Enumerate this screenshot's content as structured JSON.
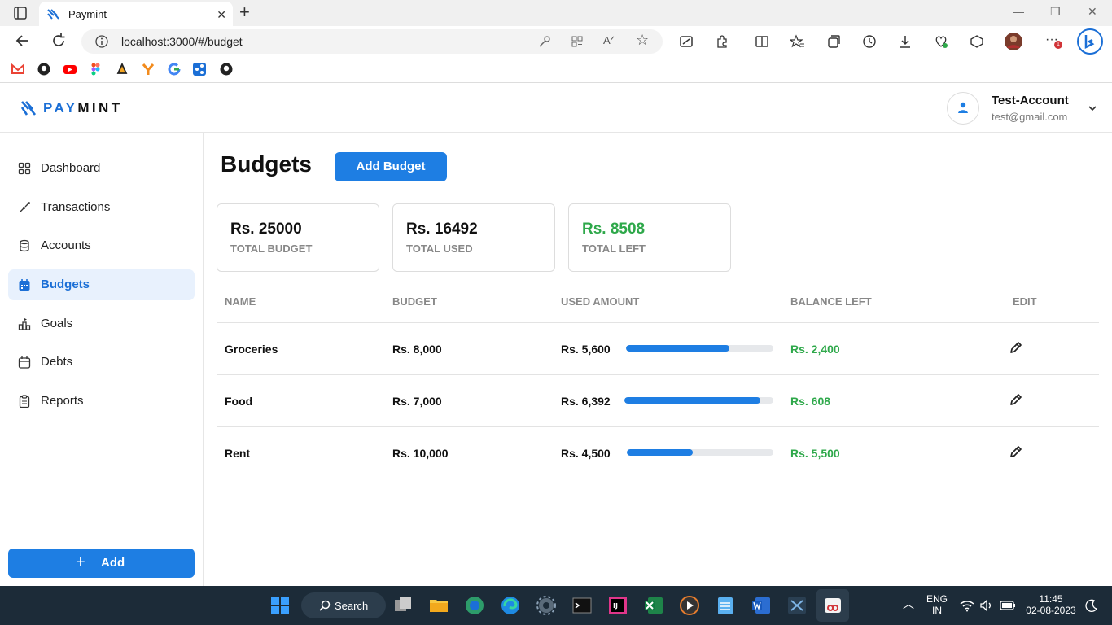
{
  "browser": {
    "tab_title": "Paymint",
    "url": "localhost:3000/#/budget"
  },
  "app": {
    "logo_left": "PAY",
    "logo_right": "MINT"
  },
  "profile": {
    "name": "Test-Account",
    "email": "test@gmail.com"
  },
  "sidebar": {
    "items": [
      {
        "label": "Dashboard",
        "icon": "grid-icon"
      },
      {
        "label": "Transactions",
        "icon": "arrows-icon"
      },
      {
        "label": "Accounts",
        "icon": "database-icon"
      },
      {
        "label": "Budgets",
        "icon": "calendar-icon",
        "active": true
      },
      {
        "label": "Goals",
        "icon": "goals-icon"
      },
      {
        "label": "Debts",
        "icon": "calendar-icon"
      },
      {
        "label": "Reports",
        "icon": "clipboard-icon"
      }
    ],
    "add_label": "Add"
  },
  "page": {
    "title": "Budgets",
    "add_budget_label": "Add Budget"
  },
  "summary": [
    {
      "value": "Rs. 25000",
      "caption": "TOTAL BUDGET"
    },
    {
      "value": "Rs. 16492",
      "caption": "TOTAL USED"
    },
    {
      "value": "Rs. 8508",
      "caption": "TOTAL LEFT"
    }
  ],
  "table": {
    "headers": [
      "NAME",
      "BUDGET",
      "USED AMOUNT",
      "BALANCE LEFT",
      "EDIT"
    ],
    "rows": [
      {
        "name": "Groceries",
        "budget": "Rs. 8,000",
        "used": "Rs. 5,600",
        "used_fraction": 0.7,
        "balance": "Rs. 2,400"
      },
      {
        "name": "Food",
        "budget": "Rs. 7,000",
        "used": "Rs. 6,392",
        "used_fraction": 0.913,
        "balance": "Rs. 608"
      },
      {
        "name": "Rent",
        "budget": "Rs. 10,000",
        "used": "Rs. 4,500",
        "used_fraction": 0.45,
        "balance": "Rs. 5,500"
      }
    ]
  },
  "taskbar": {
    "search_label": "Search",
    "lang_top": "ENG",
    "lang_bottom": "IN",
    "time": "11:45",
    "date": "02-08-2023"
  },
  "colors": {
    "accent": "#1e7ee3",
    "positive": "#2ea84a",
    "active_bg": "#e8f1fd"
  }
}
